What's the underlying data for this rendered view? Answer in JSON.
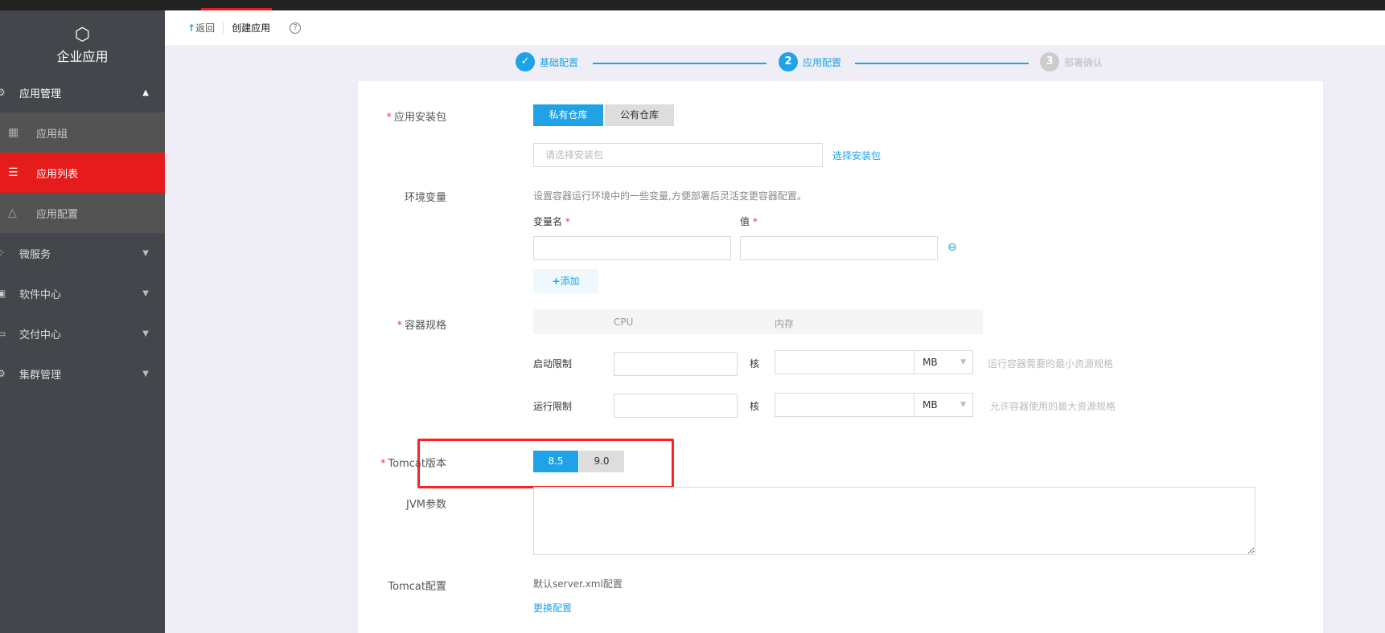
{
  "sidebar": {
    "title": "企业应用",
    "groups": [
      {
        "label": "应用管理",
        "expanded": true
      },
      {
        "label": "微服务"
      },
      {
        "label": "软件中心"
      },
      {
        "label": "交付中心"
      },
      {
        "label": "集群管理"
      }
    ],
    "subitems": [
      {
        "label": "应用组"
      },
      {
        "label": "应用列表",
        "active": true
      },
      {
        "label": "应用配置"
      }
    ]
  },
  "header": {
    "back": "返回",
    "title": "创建应用",
    "help": "?"
  },
  "steps": [
    {
      "num": "✓",
      "label": "基础配置",
      "state": "done"
    },
    {
      "num": "2",
      "label": "应用配置",
      "state": "current"
    },
    {
      "num": "3",
      "label": "部署确认",
      "state": "pending"
    }
  ],
  "form": {
    "package": {
      "label": "应用安装包",
      "options": [
        "私有仓库",
        "公有仓库"
      ],
      "selected": "私有仓库",
      "placeholder": "请选择安装包",
      "link": "选择安装包"
    },
    "env": {
      "label": "环境变量",
      "hint": "设置容器运行环境中的一些变量,方便部署后灵活变更容器配置。",
      "name_col": "变量名",
      "value_col": "值",
      "add": "添加"
    },
    "spec": {
      "label": "容器规格",
      "cpu_col": "CPU",
      "mem_col": "内存",
      "rows": [
        {
          "label": "启动限制",
          "unit": "核",
          "mem_unit": "MB",
          "hint": "运行容器需要的最小资源规格"
        },
        {
          "label": "运行限制",
          "unit": "核",
          "mem_unit": "MB",
          "hint": "允许容器使用的最大资源规格"
        }
      ]
    },
    "tomcat_version": {
      "label": "Tomcat版本",
      "options": [
        "8.5",
        "9.0"
      ],
      "selected": "8.5"
    },
    "jvm": {
      "label": "JVM参数"
    },
    "tomcat_config": {
      "label": "Tomcat配置",
      "value": "默认server.xml配置",
      "link": "更换配置"
    }
  },
  "colors": {
    "accent": "#1fa3e6",
    "active": "#e61b1b",
    "highlight_box": "#ff2020"
  }
}
